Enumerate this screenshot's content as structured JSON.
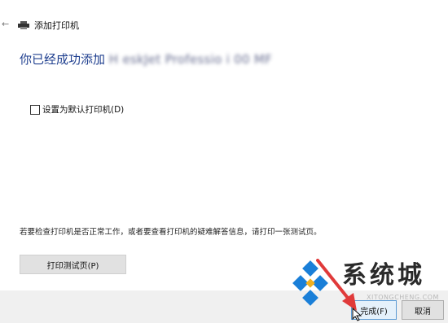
{
  "window": {
    "back_icon": "back-arrow-icon",
    "printer_icon": "printer-icon",
    "title": "添加打印机"
  },
  "main": {
    "heading_prefix": "你已经成功添加",
    "heading_printer_name": "H          eskJet Professio    i        00 MF",
    "set_default_label": "设置为默认打印机(D)",
    "set_default_checked": false,
    "info_text": "若要检查打印机是否正常工作，或者要查看打印机的疑难解答信息，请打印一张测试页。",
    "print_test_label": "打印测试页(P)"
  },
  "footer": {
    "finish_label": "完成(F)",
    "cancel_label": "取消"
  },
  "watermark": {
    "text": "系统城",
    "url": "XITONGCHENG.COM"
  },
  "colors": {
    "heading": "#1f3f8f",
    "footer_bg": "#f0f0f0",
    "primary_border": "#5b9bd5",
    "arrow": "#e03a3a",
    "logo_blue": "#1a7fd8"
  }
}
